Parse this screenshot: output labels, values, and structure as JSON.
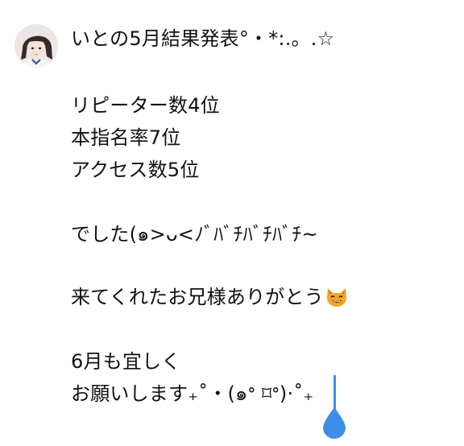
{
  "post": {
    "avatar_icon": "user-avatar-photo",
    "lines": [
      "いとの5月結果発表°・*:.。.☆",
      "リピーター数4位",
      "本指名率7位",
      "アクセス数5位",
      "でした(๑>ᴗ<ﾉﾞﾊﾞﾁﾊﾞﾁﾊﾞﾁ~",
      "来てくれたお兄様ありがとう",
      "6月も宜しく",
      "お願いします₊˚・(๑ᐤ ⌑ᐤ)·˚₊"
    ],
    "emoji_icon": "grinning-cat-emoji"
  },
  "colors": {
    "text": "#111111",
    "cursor": "#3d8ee8",
    "background": "#ffffff"
  }
}
